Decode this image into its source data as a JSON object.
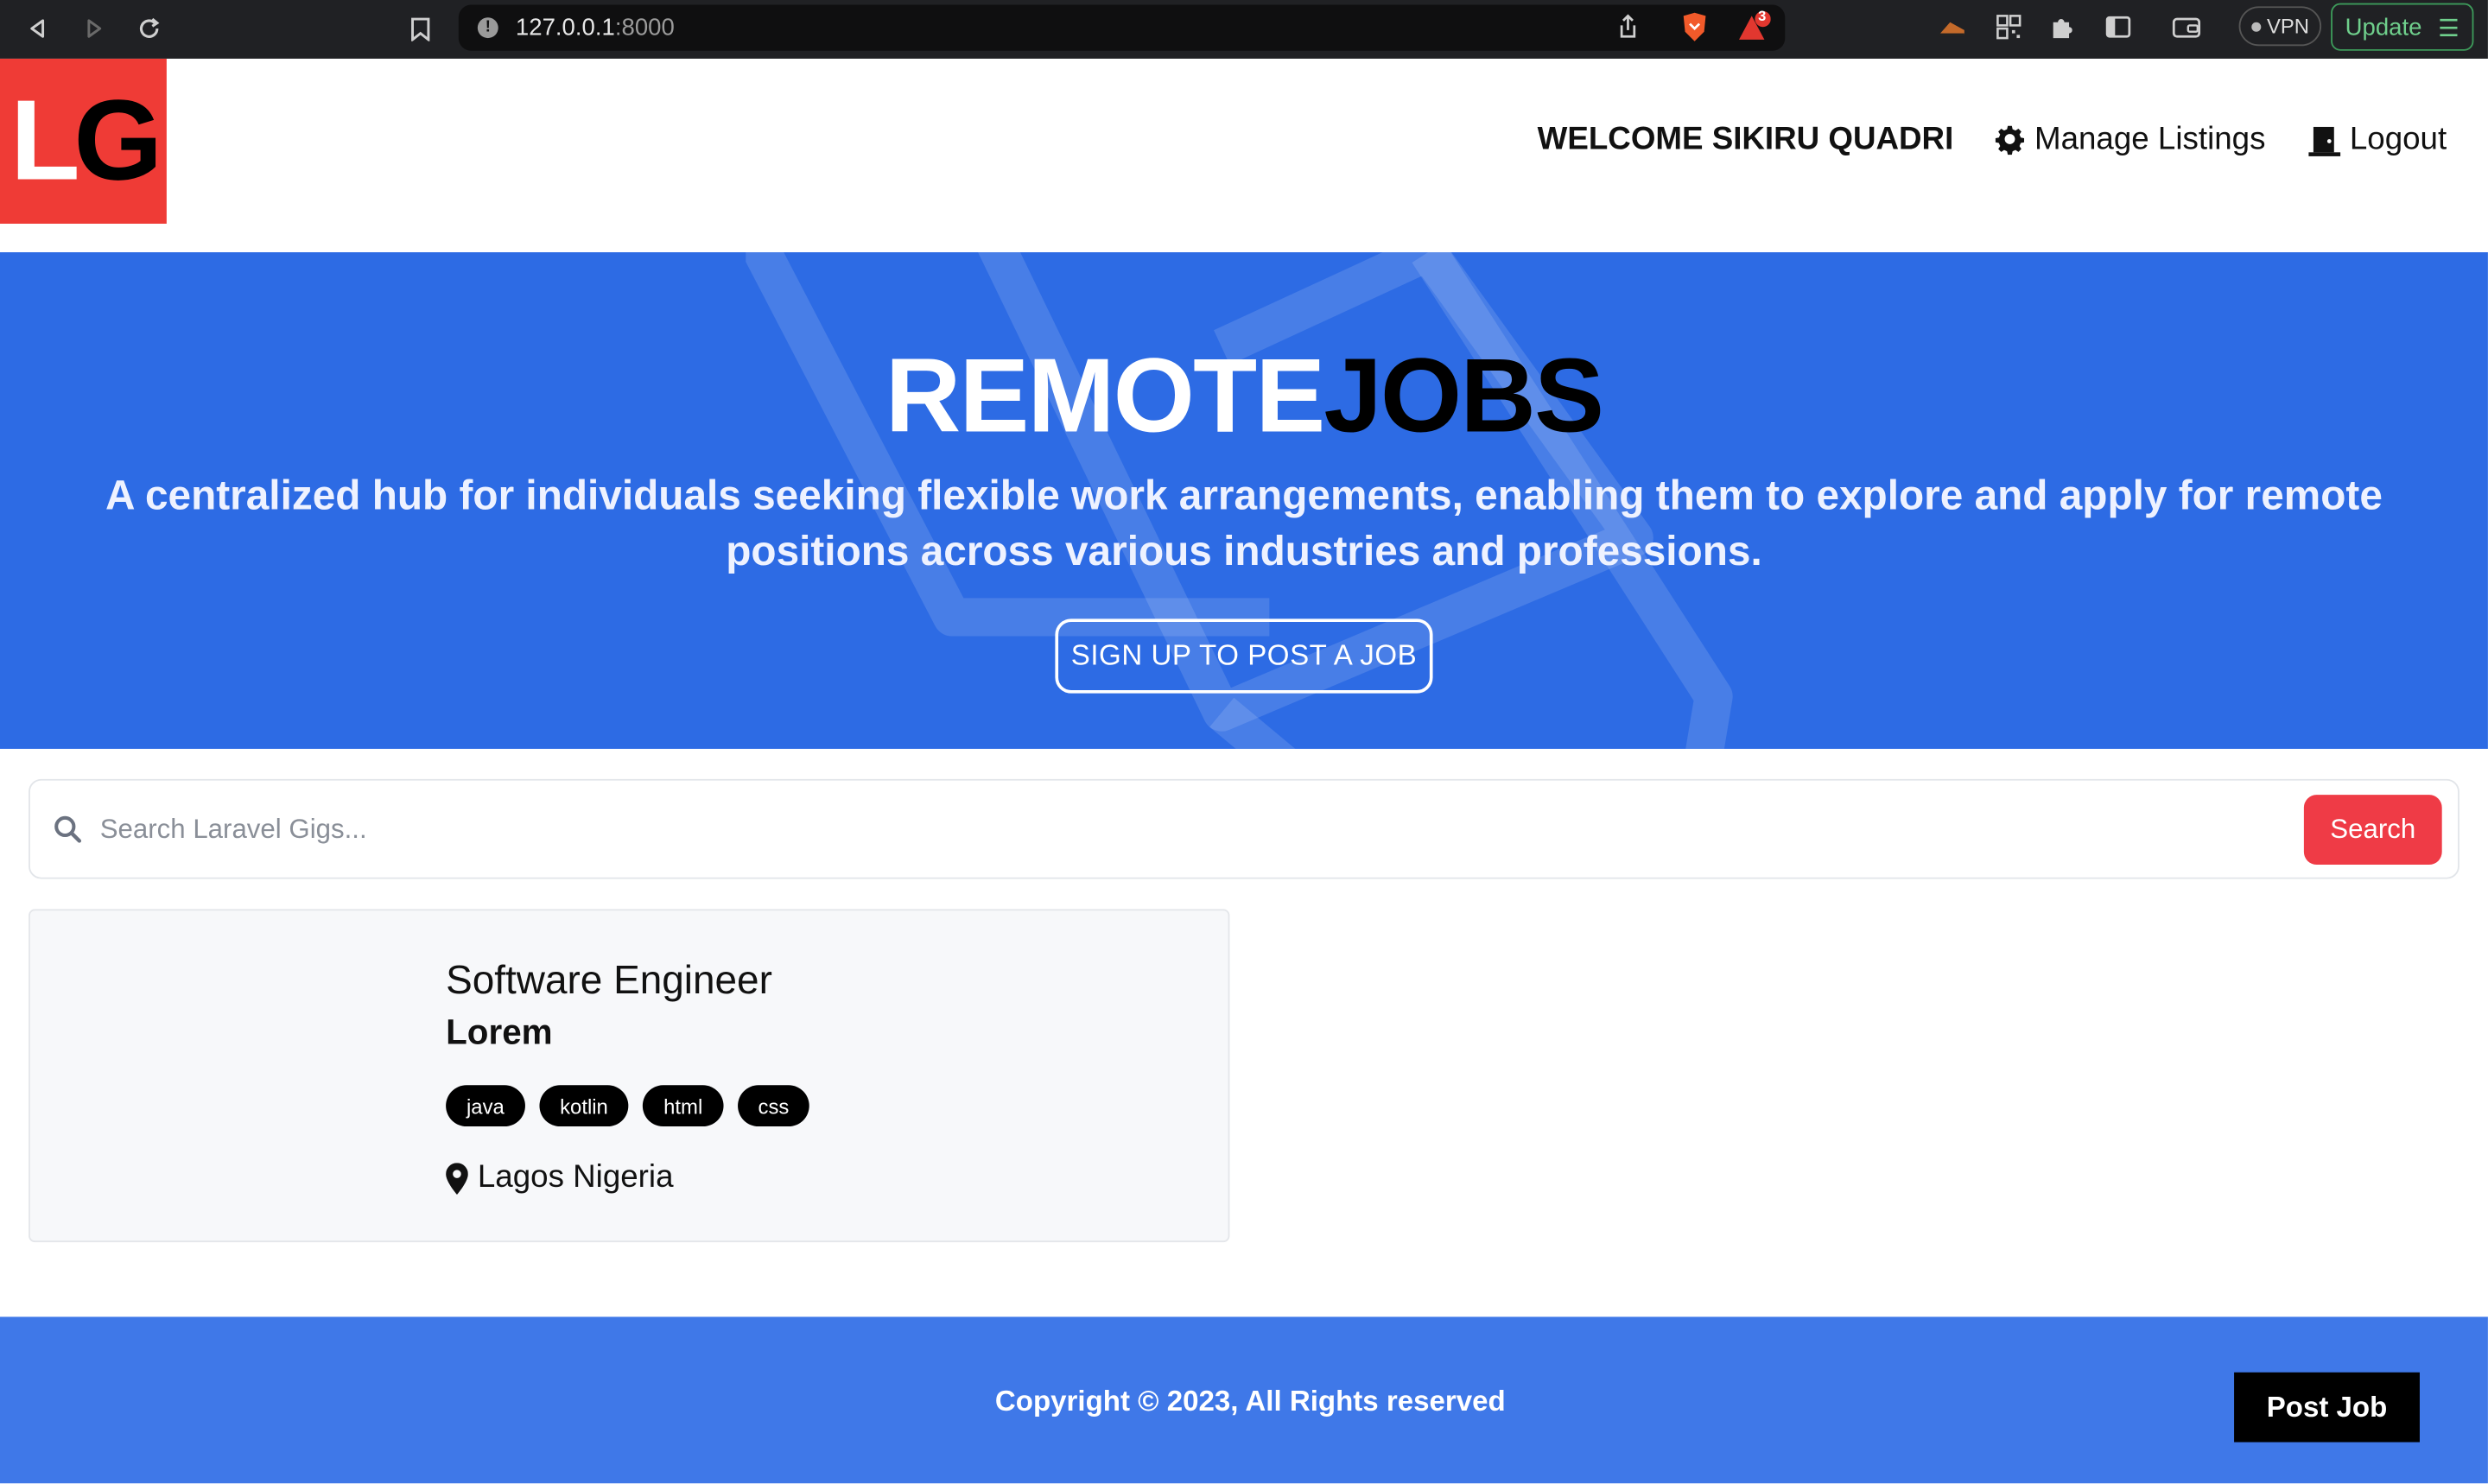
{
  "browser": {
    "url_host": "127.0.0.1",
    "url_port": ":8000",
    "badge_count": "3",
    "vpn_label": "VPN",
    "update_label": "Update"
  },
  "header": {
    "logo_left": "L",
    "logo_right": "G",
    "welcome": "Welcome Sikiru Quadri",
    "manage_listings": "Manage Listings",
    "logout": "Logout"
  },
  "hero": {
    "title_white": "REMOTE",
    "title_black": "JOBS",
    "tagline": "A centralized hub for individuals seeking flexible work arrangements, enabling them to explore and apply for remote positions across various industries and professions.",
    "cta": "Sign Up to Post a Job"
  },
  "search": {
    "placeholder": "Search Laravel Gigs...",
    "button": "Search"
  },
  "listings": [
    {
      "title": "Software Engineer",
      "company": "Lorem",
      "tags": [
        "java",
        "kotlin",
        "html",
        "css"
      ],
      "location": "Lagos Nigeria"
    }
  ],
  "footer": {
    "copyright": "Copyright © 2023, All Rights reserved",
    "post_job": "Post Job"
  },
  "colors": {
    "brand_red": "#ef3b36",
    "hero_blue": "#2d6be4",
    "footer_blue": "#3f78e8",
    "search_red": "#ef3b46"
  }
}
